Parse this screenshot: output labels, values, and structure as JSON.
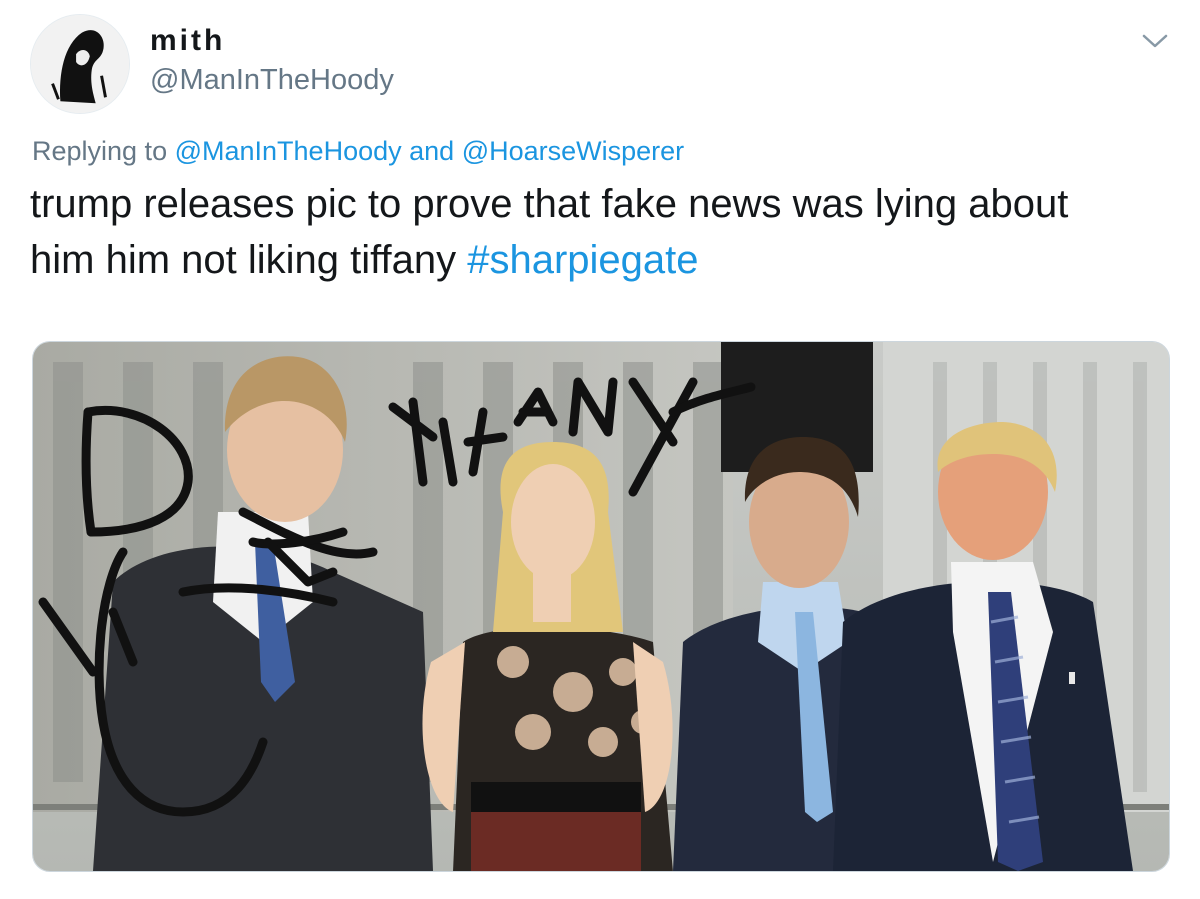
{
  "user": {
    "display_name": "mith",
    "handle": "@ManInTheHoody",
    "avatar_icon": "hooded-figure-avatar"
  },
  "menu": {
    "icon": "chevron-down-icon"
  },
  "reply": {
    "prefix": "Replying to ",
    "mention_1": "@ManInTheHoody",
    "connector": " and ",
    "mention_2": "@HoarseWisperer"
  },
  "tweet": {
    "text": "trump releases pic to prove that fake news was lying about him him not liking tiffany ",
    "hashtag": "#sharpiegate"
  },
  "media": {
    "scribble_text": "TIFANY"
  },
  "colors": {
    "link": "#1b95e0",
    "secondary_text": "#657786",
    "primary_text": "#14171a",
    "border": "#ccd6dd"
  }
}
